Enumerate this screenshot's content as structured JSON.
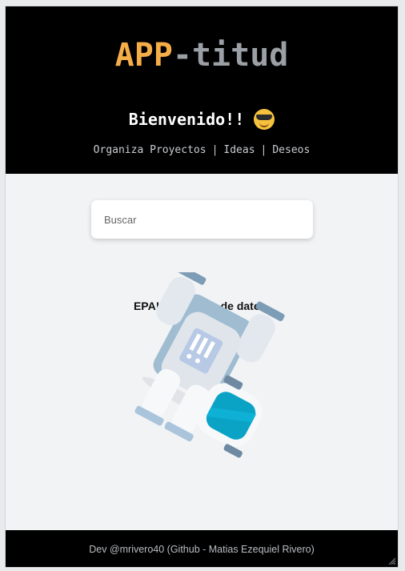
{
  "header": {
    "logo_part1": "APP",
    "logo_part2": "-titud",
    "welcome": "Bienvenido!!",
    "welcome_emoji_icon": "smiling-face-with-sunglasses-icon",
    "nav": {
      "item1": "Organiza Proyectos",
      "sep": "|",
      "item2": "Ideas",
      "item3": "Deseos"
    }
  },
  "search": {
    "placeholder": "Buscar",
    "value": ""
  },
  "status": {
    "message": "EPA!!! En carga de datos."
  },
  "illustration": {
    "icon": "floating-astronaut-icon"
  },
  "footer": {
    "credit": "Dev @mrivero40 (Github - Matias Ezequiel Rivero)"
  },
  "colors": {
    "logo_accent": "#f5ad48",
    "logo_secondary": "#9aa0a6",
    "header_bg": "#000000",
    "page_bg": "#f2f3f5"
  }
}
